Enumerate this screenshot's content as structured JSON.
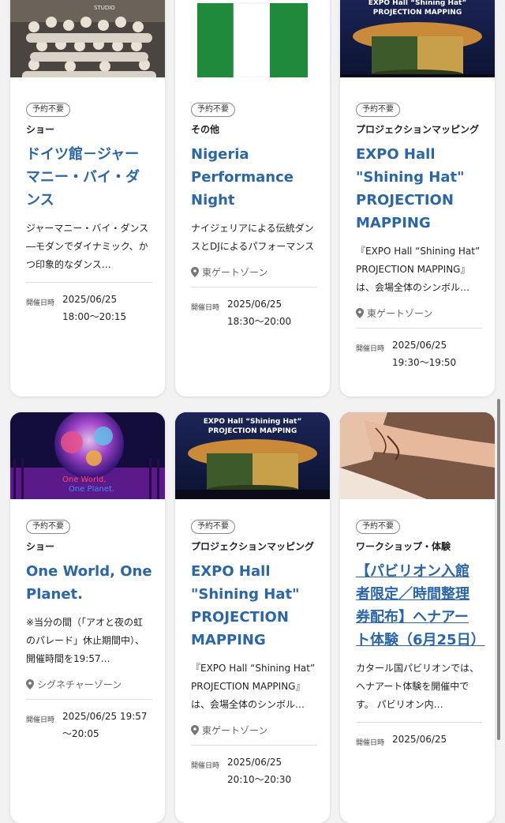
{
  "cards": [
    {
      "badge": "予約不要",
      "category": "ショー",
      "title": "ドイツ館－ジャーマニー・バイ・ダンス",
      "desc": "ジャーマニー・バイ・ダンス―モダンでダイナミック、かつ印象的なダンス…",
      "date_label": "開催日時",
      "date_line1": "2025/06/25",
      "date_line2": "18:00～20:15"
    },
    {
      "badge": "予約不要",
      "category": "その他",
      "title": "Nigeria Performance Night",
      "desc": "ナイジェリアによる伝統ダンスとDJによるパフォーマンス",
      "location": "東ゲートゾーン",
      "date_label": "開催日時",
      "date_line1": "2025/06/25",
      "date_line2": "18:30～20:00"
    },
    {
      "badge": "予約不要",
      "category": "プロジェクションマッピング",
      "title": "EXPO Hall \"Shining Hat\" PROJECTION MAPPING",
      "desc": "『EXPO Hall “Shining Hat” PROJECTION MAPPING』は、会場全体のシンボル…",
      "location": "東ゲートゾーン",
      "date_label": "開催日時",
      "date_line1": "2025/06/25",
      "date_line2": "19:30～19:50",
      "image_text_1": "EXPO Hall “Shining Hat”",
      "image_text_2": "PROJECTION MAPPING"
    },
    {
      "badge": "予約不要",
      "category": "ショー",
      "title": "One World, One Planet.",
      "desc": "※当分の間（「アオと夜の虹のパレード」休止期間中）、開催時間を19:57…",
      "location": "シグネチャーゾーン",
      "date_label": "開催日時",
      "date_line1": "2025/06/25 19:57",
      "date_line2": "～20:05",
      "image_text_1": "One World,",
      "image_text_2": "One Planet."
    },
    {
      "badge": "予約不要",
      "category": "プロジェクションマッピング",
      "title": "EXPO Hall \"Shining Hat\" PROJECTION MAPPING",
      "desc": "『EXPO Hall “Shining Hat” PROJECTION MAPPING』は、会場全体のシンボル…",
      "location": "東ゲートゾーン",
      "date_label": "開催日時",
      "date_line1": "2025/06/25",
      "date_line2": "20:10～20:30",
      "image_text_1": "EXPO Hall “Shining Hat”",
      "image_text_2": "PROJECTION MAPPING"
    },
    {
      "badge": "予約不要",
      "category": "ワークショップ・体験",
      "title": "【パビリオン入館者限定／時間整理券配布】ヘナアート体験（6月25日）",
      "desc": "カタール国パビリオンでは、ヘナアート体験を開催中です。 パビリオン内…",
      "date_label": "開催日時",
      "date_line1": "2025/06/25"
    }
  ],
  "image_texts": {
    "studio": "STUDIO"
  },
  "colors": {
    "title": "#2a66a8",
    "nigeria_green": "#1f8a3a"
  }
}
